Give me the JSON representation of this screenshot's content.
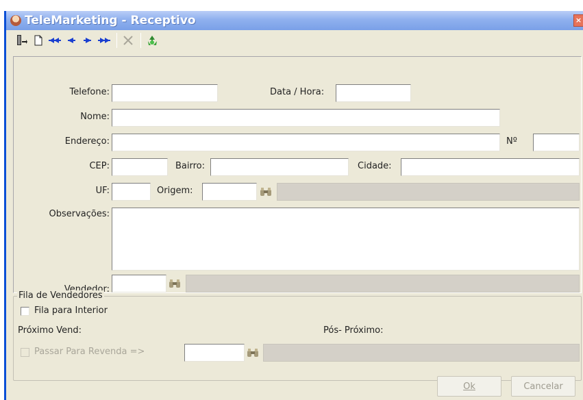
{
  "window": {
    "title": "TeleMarketing - Receptivo",
    "close_label": "×"
  },
  "toolbar": {
    "buttons": [
      {
        "name": "exit-icon"
      },
      {
        "name": "new-document-icon"
      },
      {
        "name": "first-record-icon"
      },
      {
        "name": "previous-record-icon"
      },
      {
        "name": "next-record-icon"
      },
      {
        "name": "last-record-icon"
      },
      {
        "name": "delete-icon"
      },
      {
        "name": "recycle-icon"
      }
    ]
  },
  "form": {
    "telefone_label": "Telefone:",
    "data_hora_label": "Data / Hora:",
    "nome_label": "Nome:",
    "endereco_label": "Endereço:",
    "numero_label": "Nº",
    "cep_label": "CEP:",
    "bairro_label": "Bairro:",
    "cidade_label": "Cidade:",
    "uf_label": "UF:",
    "origem_label": "Origem:",
    "observacoes_label": "Observações:",
    "vendedor_label": "Vendedor:",
    "values": {
      "telefone": "",
      "data_hora": "",
      "nome": "",
      "endereco": "",
      "numero": "",
      "cep": "",
      "bairro": "",
      "cidade": "",
      "uf": "",
      "origem": "",
      "origem_desc": "",
      "observacoes": "",
      "vendedor": "",
      "vendedor_desc": ""
    }
  },
  "fila": {
    "group_title": "Fila de Vendedores",
    "fila_interior_label": "Fila para Interior",
    "proximo_vend_label": "Próximo Vend:",
    "pos_proximo_label": "Pós- Próximo:",
    "passar_revenda_label": "Passar Para Revenda =>"
  },
  "buttons": {
    "ok_label": "Ok",
    "cancelar_label": "Cancelar"
  },
  "colors": {
    "title_bar": "#8fb0ee",
    "window_bg": "#ece9d8",
    "window_border": "#0a4fd6"
  }
}
